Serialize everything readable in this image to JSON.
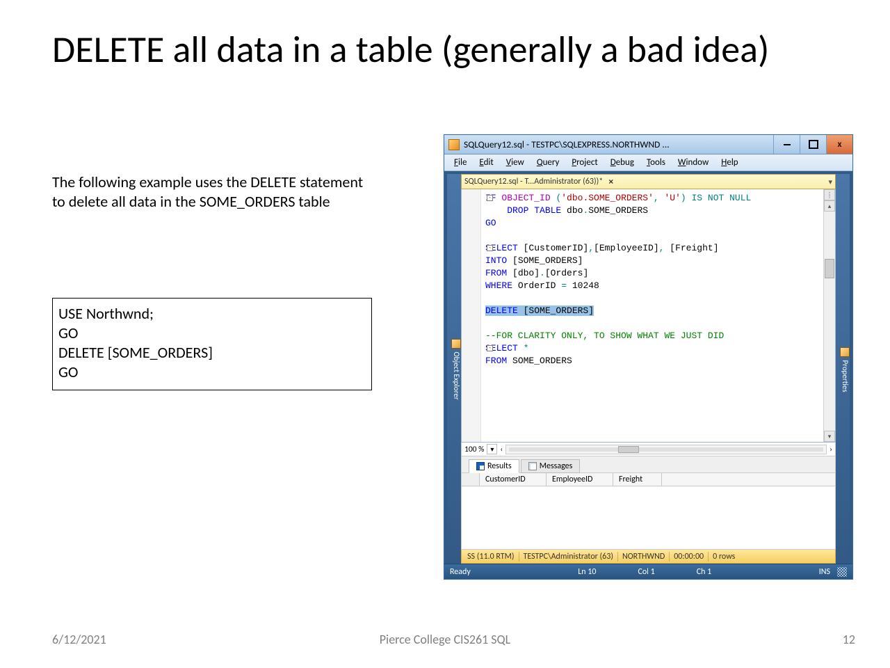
{
  "slide": {
    "title": "DELETE all data in a table (generally a bad idea)",
    "body": "The following example uses the DELETE statement to delete all data in the SOME_ORDERS table",
    "snippet": "USE Northwnd;\nGO\nDELETE [SOME_ORDERS]\nGO",
    "date": "6/12/2021",
    "footer": "Pierce College CIS261 SQL",
    "page": "12"
  },
  "ssms": {
    "title": "SQLQuery12.sql - TESTPC\\SQLEXPRESS.NORTHWND ...",
    "menus": [
      "File",
      "Edit",
      "View",
      "Query",
      "Project",
      "Debug",
      "Tools",
      "Window",
      "Help"
    ],
    "tab": "SQLQuery12.sql - T...Administrator (63))*",
    "left_rail": "Object Explorer",
    "right_rail": "Properties",
    "code": {
      "l1a": "IF",
      "l1b": " OBJECT_ID ",
      "l1c": "(",
      "l1d": "'dbo.SOME_ORDERS'",
      "l1e": ", ",
      "l1f": "'U'",
      "l1g": ")",
      "l1h": " IS NOT NULL",
      "l2a": "    DROP TABLE",
      "l2b": " dbo",
      "l2c": ".",
      "l2d": "SOME_ORDERS",
      "l3": "GO",
      "l5a": "SELECT",
      "l5b": " [CustomerID]",
      "l5c": ",",
      "l5d": "[EmployeeID]",
      "l5e": ", ",
      "l5f": "[Freight]",
      "l6a": "INTO",
      "l6b": " [SOME_ORDERS]",
      "l7a": "FROM",
      "l7b": " [dbo]",
      "l7c": ".",
      "l7d": "[Orders]",
      "l8a": "WHERE",
      "l8b": " OrderID ",
      "l8c": "= ",
      "l8d": "10248",
      "l10a": "DELETE",
      "l10b": " [SOME_ORDERS]",
      "l12": "--FOR CLARITY ONLY, TO SHOW WHAT WE JUST DID",
      "l13a": "SELECT",
      "l13b": " *",
      "l14a": "FROM",
      "l14b": " SOME_ORDERS"
    },
    "zoom": "100 %",
    "results_tabs": {
      "results": "Results",
      "messages": "Messages"
    },
    "grid_cols": [
      "CustomerID",
      "EmployeeID",
      "Freight"
    ],
    "yellow": [
      "SS (11.0 RTM)",
      "TESTPC\\Administrator (63)",
      "NORTHWND",
      "00:00:00",
      "0 rows"
    ],
    "status": {
      "ready": "Ready",
      "ln": "Ln 10",
      "col": "Col 1",
      "ch": "Ch 1",
      "ins": "INS"
    }
  }
}
